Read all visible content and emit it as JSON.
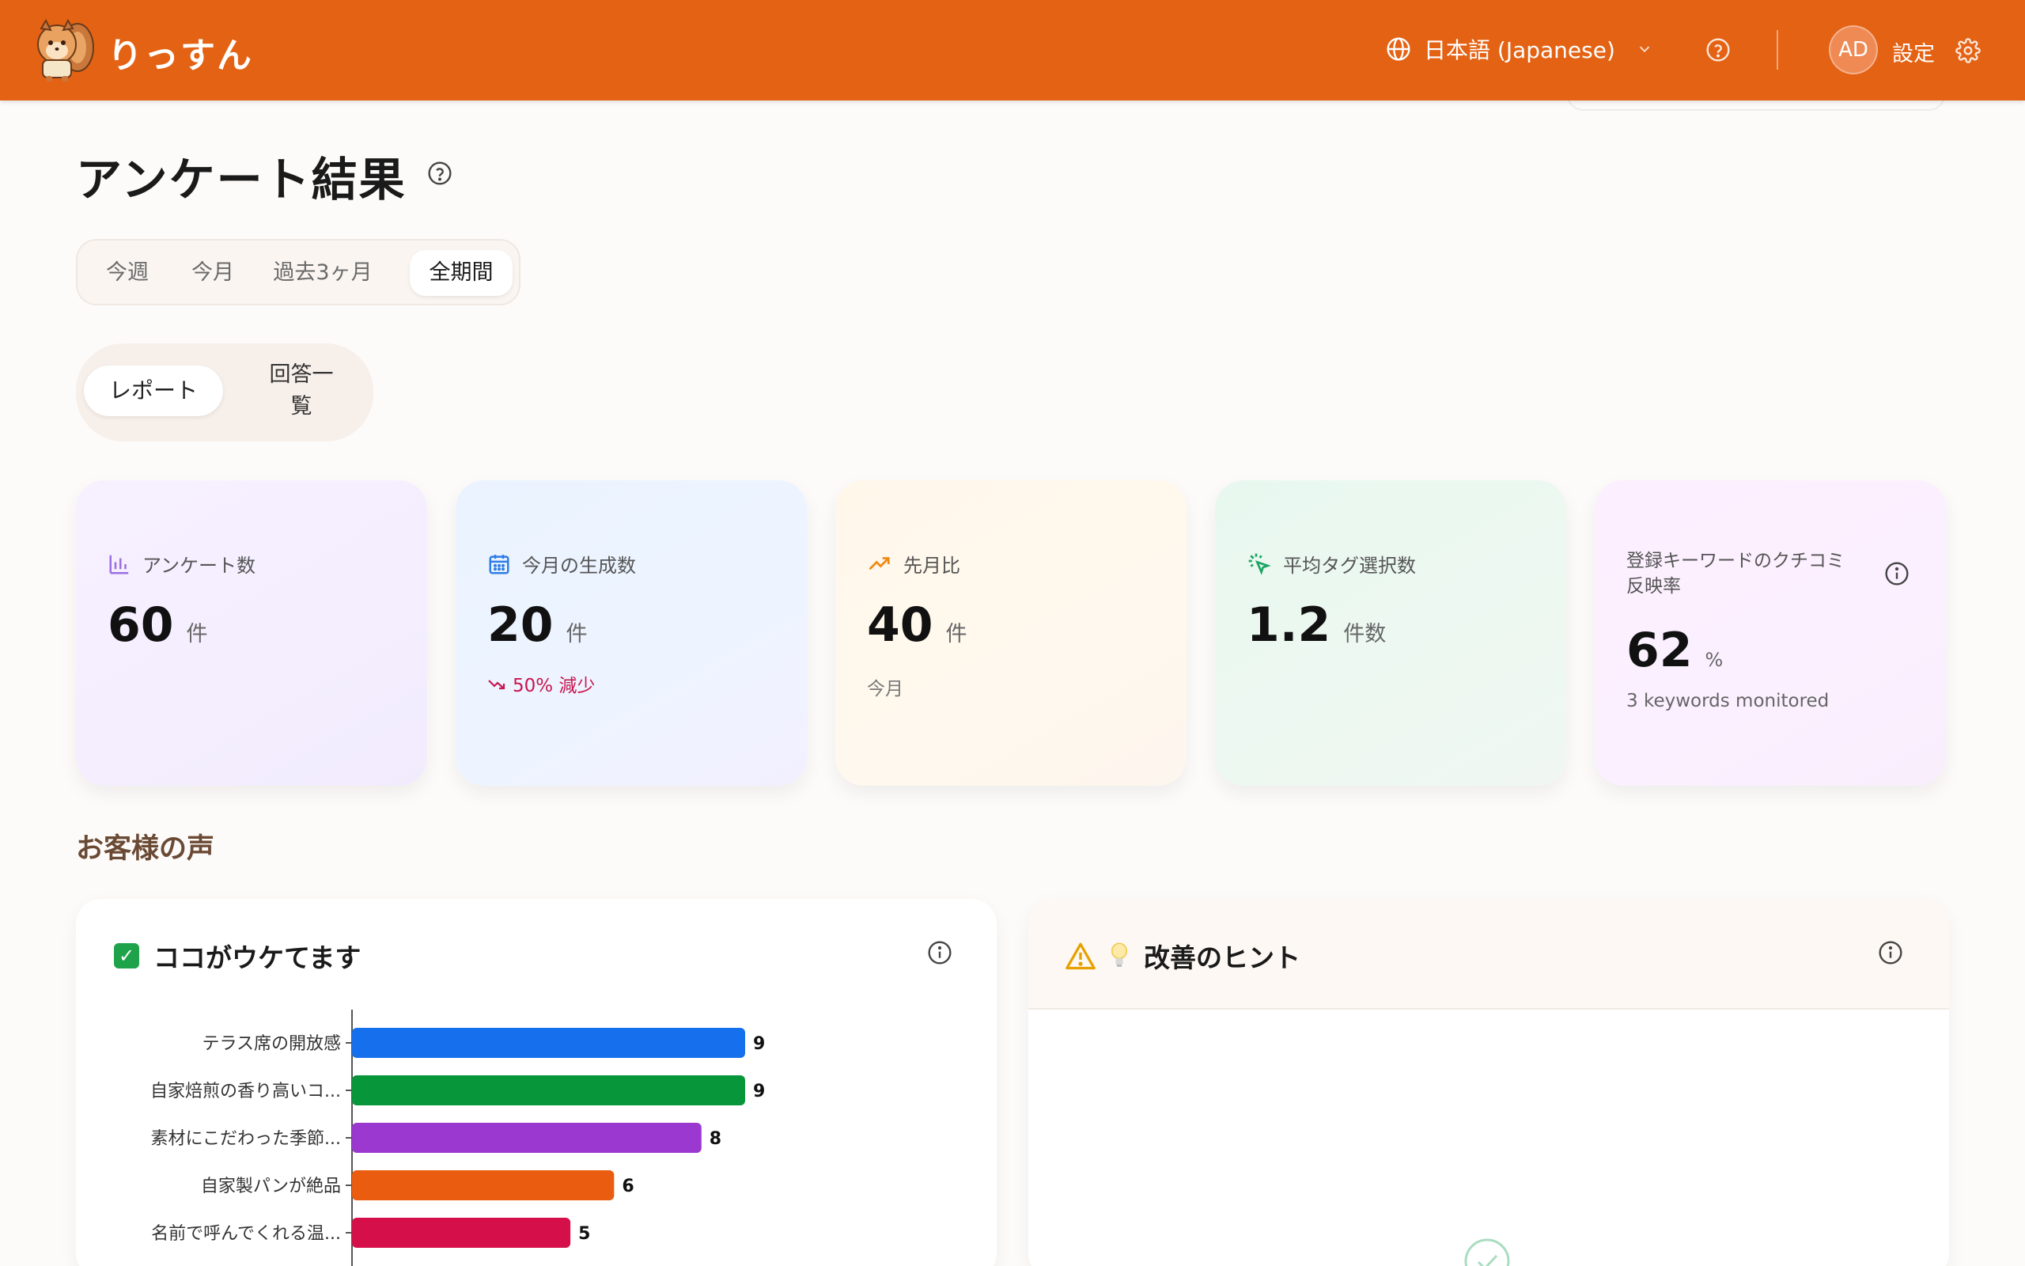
{
  "header": {
    "brand": "りっすん",
    "language": "日本語 (Japanese)",
    "avatar_initials": "AD",
    "settings_label": "設定",
    "bg_color": "#e46213"
  },
  "page": {
    "title": "アンケート結果"
  },
  "periods": [
    "今週",
    "今月",
    "過去3ヶ月",
    "全期間"
  ],
  "selected_period": "全期間",
  "view_toggle": {
    "report": "レポート",
    "list_line1": "回答一",
    "list_line2": "覧",
    "selected": "レポート"
  },
  "kpis": [
    {
      "label": "アンケート数",
      "value": "60",
      "unit": "件",
      "icon": "bar-chart-icon"
    },
    {
      "label": "今月の生成数",
      "value": "20",
      "unit": "件",
      "sub": "50% 減少",
      "icon": "calendar-icon"
    },
    {
      "label": "先月比",
      "value": "40",
      "unit": "件",
      "sub": "今月",
      "icon": "trending-up-icon"
    },
    {
      "label": "平均タグ選択数",
      "value": "1.2",
      "unit": "件数",
      "icon": "cursor-click-icon"
    },
    {
      "label_line1": "登録キーワードのクチコミ",
      "label_line2": "反映率",
      "value": "62",
      "unit": "%",
      "sub": "3 keywords monitored",
      "icon": "info-icon"
    }
  ],
  "section": {
    "voices_title": "お客様の声"
  },
  "strengths": {
    "title": "ココがウケてます",
    "emoji": "✅"
  },
  "improvements": {
    "title": "改善のヒント",
    "emoji": "💡"
  },
  "chart_data": {
    "type": "bar",
    "orientation": "horizontal",
    "categories": [
      "テラス席の開放感",
      "自家焙煎の香り高いコ...",
      "素材にこだわった季節...",
      "自家製パンが絶品",
      "名前で呼んでくれる温..."
    ],
    "values": [
      9,
      9,
      8,
      6,
      5
    ],
    "colors": [
      "#1670ee",
      "#08963a",
      "#9a38d0",
      "#ea5c10",
      "#d40f4a"
    ],
    "xlim": [
      0,
      9
    ]
  }
}
